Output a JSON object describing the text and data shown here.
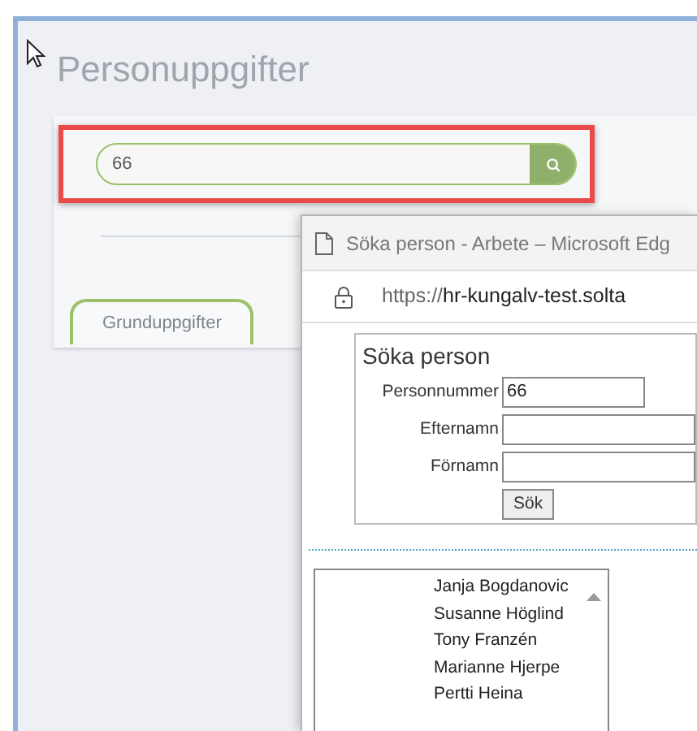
{
  "page": {
    "title": "Personuppgifter",
    "search": {
      "value": "66"
    },
    "tabs": [
      {
        "label": "Grunduppgifter",
        "selected": true
      }
    ]
  },
  "popup": {
    "window_title": "Söka person - Arbete – Microsoft Edg",
    "url_prefix": "https://",
    "url_host": "hr-kungalv-test.solta",
    "form": {
      "title": "Söka person",
      "fields": [
        {
          "label": "Personnummer",
          "value": "66"
        },
        {
          "label": "Efternamn"
        },
        {
          "label": "Förnamn"
        }
      ],
      "button": "Sök"
    },
    "results": [
      "Janja Bogdanovic",
      "Susanne Höglind",
      "Tony Franzén",
      "Marianne Hjerpe",
      "Pertti Heina"
    ]
  }
}
